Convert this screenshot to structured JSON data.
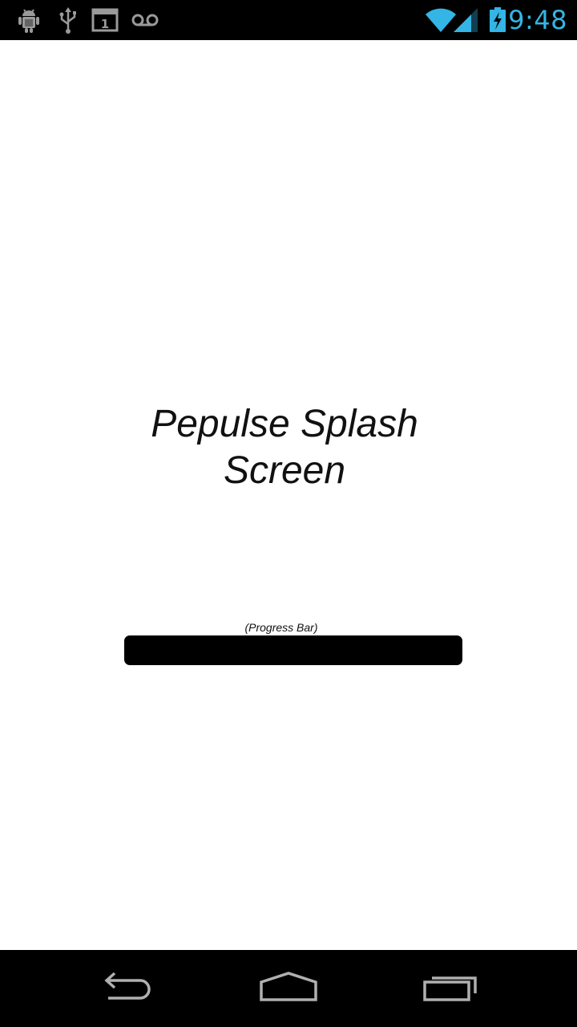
{
  "status_bar": {
    "time": "9:48",
    "left_icons": [
      "android-debug-icon",
      "usb-icon",
      "calendar-icon",
      "voicemail-icon"
    ],
    "calendar_day": "1",
    "right_icons": [
      "wifi-icon",
      "cell-signal-icon",
      "battery-charging-icon"
    ],
    "accent_color": "#33b5e5"
  },
  "splash": {
    "title_line1": "Pepulse Splash",
    "title_line2": "Screen",
    "progress_caption": "(Progress Bar)",
    "progress_fraction": 1.0
  },
  "nav_bar": {
    "buttons": [
      "back-icon",
      "home-icon",
      "recent-apps-icon"
    ]
  }
}
